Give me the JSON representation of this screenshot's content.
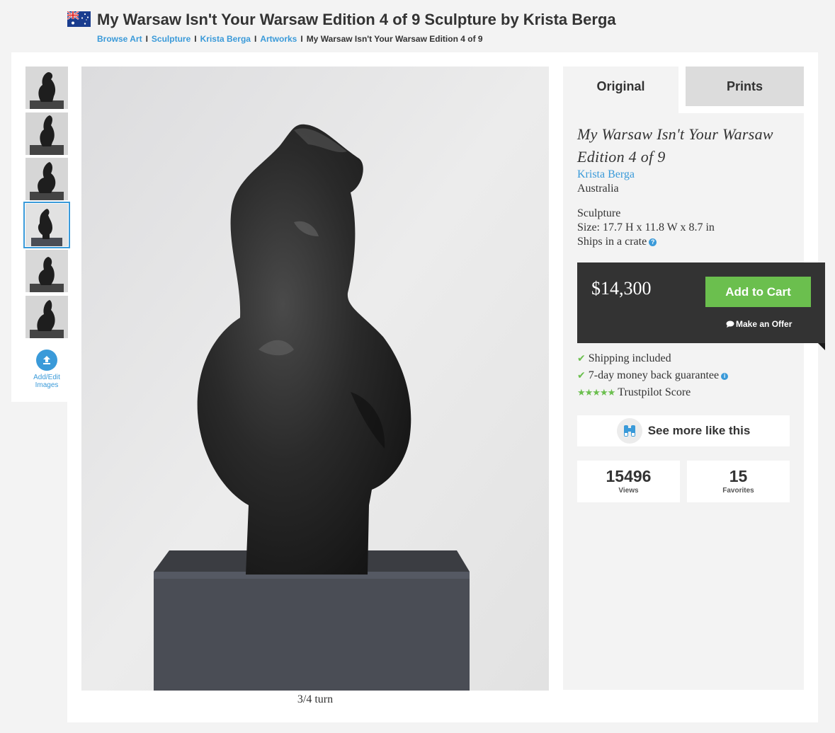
{
  "header": {
    "flag_icon": "australia-flag-icon",
    "title": "My Warsaw Isn't Your Warsaw Edition 4 of 9 Sculpture by Krista Berga",
    "breadcrumb": [
      {
        "label": "Browse Art"
      },
      {
        "label": "Sculpture"
      },
      {
        "label": "Krista Berga"
      },
      {
        "label": "Artworks"
      },
      {
        "label": "My Warsaw Isn't Your Warsaw Edition 4 of 9"
      }
    ]
  },
  "thumbnails": {
    "count": 6,
    "selected_index": 3,
    "upload_label_line1": "Add/Edit",
    "upload_label_line2": "Images"
  },
  "main_image": {
    "caption": "3/4 turn"
  },
  "tabs": {
    "original": "Original",
    "prints": "Prints",
    "active": "Original"
  },
  "artwork": {
    "title_line1": "My Warsaw Isn't Your Warsaw",
    "title_line2": "Edition 4 of 9",
    "artist": "Krista Berga",
    "country": "Australia",
    "medium": "Sculpture",
    "size": "Size: 17.7 H x 11.8 W x 8.7 in",
    "ships": "Ships in a crate"
  },
  "purchase": {
    "price": "$14,300",
    "add_to_cart": "Add to Cart",
    "make_offer": "Make an Offer"
  },
  "perks": {
    "shipping": "Shipping included",
    "guarantee": "7-day money back guarantee",
    "trustpilot": "Trustpilot Score",
    "stars": 5
  },
  "see_more": "See more like this",
  "stats": {
    "views_count": "15496",
    "views_label": "Views",
    "favorites_count": "15",
    "favorites_label": "Favorites"
  },
  "colors": {
    "link": "#3a9ad9",
    "accent_green": "#6bbf4e",
    "price_box": "#333333"
  }
}
